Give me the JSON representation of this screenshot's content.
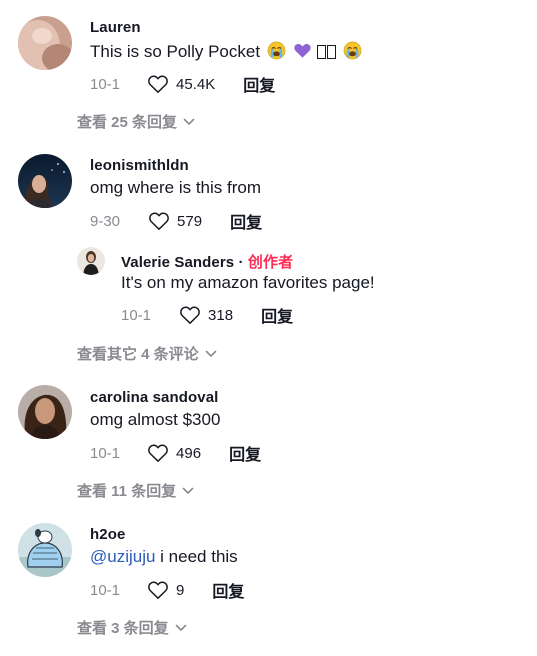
{
  "comments": [
    {
      "username": "Lauren",
      "text": "This is so Polly Pocket",
      "emoji_icons": [
        "loudly-crying-face-icon",
        "purple-heart-icon",
        "loudly-crying-face-icon"
      ],
      "date": "10-1",
      "likes": "45.4K",
      "reply_label": "回复",
      "view_replies": "查看 25 条回复"
    },
    {
      "username": "leonismithldn",
      "text": "omg where is this from",
      "date": "9-30",
      "likes": "579",
      "reply_label": "回复",
      "reply": {
        "username": "Valerie Sanders",
        "separator": " · ",
        "author_tag": "创作者",
        "text": "It's on my amazon favorites page!",
        "date": "10-1",
        "likes": "318",
        "reply_label": "回复"
      },
      "view_replies": "查看其它 4 条评论"
    },
    {
      "username": "carolina sandoval",
      "text": "omg almost $300",
      "date": "10-1",
      "likes": "496",
      "reply_label": "回复",
      "view_replies": "查看 11 条回复"
    },
    {
      "username": "h2oe",
      "mention": "@uzijuju",
      "text": " i need this",
      "date": "10-1",
      "likes": "9",
      "reply_label": "回复",
      "view_replies": "查看 3 条回复"
    }
  ],
  "colors": {
    "text": "#161823",
    "muted": "#8a8b91",
    "author_tag": "#fe2c55",
    "mention": "#2b5db9"
  },
  "icons": {
    "like": "heart-outline-icon",
    "expand": "chevron-down-icon"
  }
}
